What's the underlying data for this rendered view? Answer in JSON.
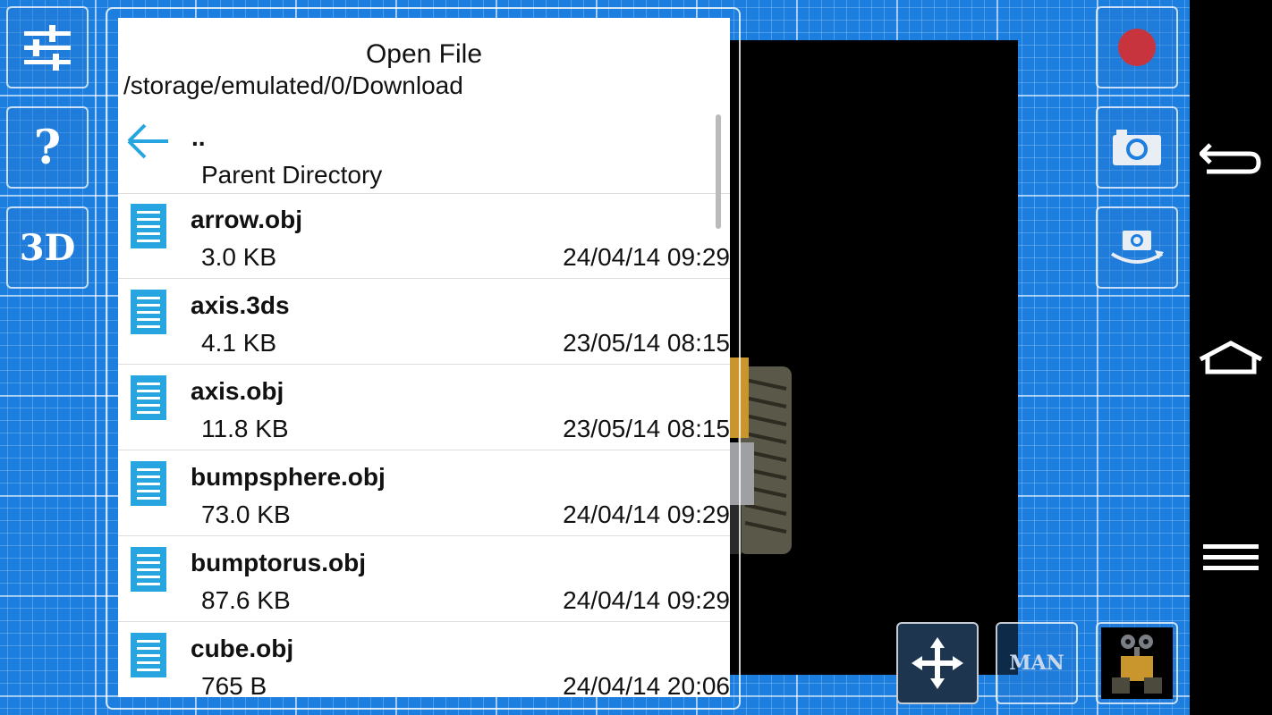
{
  "dialog": {
    "title": "Open File",
    "path": "/storage/emulated/0/Download",
    "parent": {
      "name": "..",
      "label": "Parent Directory"
    },
    "files": [
      {
        "name": "arrow.obj",
        "size": "3.0 KB",
        "date": "24/04/14 09:29"
      },
      {
        "name": "axis.3ds",
        "size": "4.1 KB",
        "date": "23/05/14 08:15"
      },
      {
        "name": "axis.obj",
        "size": "11.8 KB",
        "date": "23/05/14 08:15"
      },
      {
        "name": "bumpsphere.obj",
        "size": "73.0 KB",
        "date": "24/04/14 09:29"
      },
      {
        "name": "bumptorus.obj",
        "size": "87.6 KB",
        "date": "24/04/14 09:29"
      },
      {
        "name": "cube.obj",
        "size": "765 B",
        "date": "24/04/14 20:06"
      }
    ]
  },
  "toolbar_left": {
    "settings_icon": "sliders-icon",
    "help_label": "?",
    "view3d_label": "3D"
  },
  "toolbar_right": {
    "record_icon": "record-icon",
    "camera_icon": "camera-icon",
    "rotate_camera_icon": "rotate-camera-icon"
  },
  "toolbar_bottom": {
    "move_icon": "move-arrows-icon",
    "manual_label": "MAN",
    "model_thumbnail": "robot-thumbnail"
  },
  "navbar": {
    "back_icon": "back-icon",
    "home_icon": "home-icon",
    "menu_icon": "menu-icon"
  },
  "colors": {
    "blueprint": "#1c7fe0",
    "accent": "#27a5e0",
    "record": "#c8343e"
  }
}
